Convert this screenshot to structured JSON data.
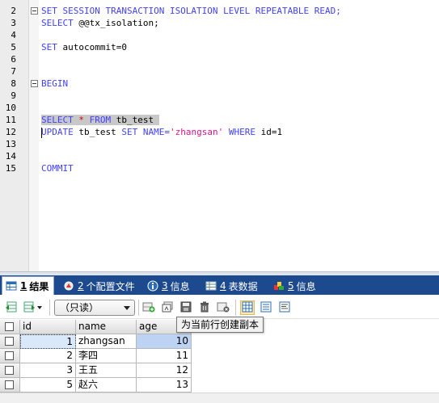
{
  "editor": {
    "lines": [
      {
        "no": "2",
        "fold": true,
        "tokens": [
          {
            "t": "SET SESSION TRANSACTION ISOLATION LEVEL REPEATABLE READ;",
            "c": "kw"
          }
        ]
      },
      {
        "no": "3",
        "fold": false,
        "tokens": [
          {
            "t": "SELECT ",
            "c": "kw"
          },
          {
            "t": "@@tx_isolation;",
            "c": ""
          }
        ]
      },
      {
        "no": "4",
        "fold": false,
        "tokens": []
      },
      {
        "no": "5",
        "fold": false,
        "tokens": [
          {
            "t": "SET ",
            "c": "kw"
          },
          {
            "t": "autocommit=0",
            "c": ""
          }
        ]
      },
      {
        "no": "6",
        "fold": false,
        "tokens": []
      },
      {
        "no": "7",
        "fold": false,
        "tokens": []
      },
      {
        "no": "8",
        "fold": true,
        "tokens": [
          {
            "t": "BEGIN",
            "c": "kw"
          }
        ]
      },
      {
        "no": "9",
        "fold": false,
        "tokens": []
      },
      {
        "no": "10",
        "fold": false,
        "tokens": []
      },
      {
        "no": "11",
        "fold": false,
        "selected": true,
        "tokens": [
          {
            "t": "SELECT ",
            "c": "kw"
          },
          {
            "t": "* ",
            "c": "op"
          },
          {
            "t": "FROM ",
            "c": "kw"
          },
          {
            "t": "tb_test ",
            "c": ""
          }
        ]
      },
      {
        "no": "12",
        "fold": false,
        "caret": true,
        "tokens": [
          {
            "t": "UPDATE ",
            "c": "kw"
          },
          {
            "t": "tb_test ",
            "c": ""
          },
          {
            "t": "SET ",
            "c": "kw"
          },
          {
            "t": "NAME=",
            "c": "kw"
          },
          {
            "t": "'zhangsan'",
            "c": "str"
          },
          {
            "t": " ",
            "c": ""
          },
          {
            "t": "WHERE ",
            "c": "kw"
          },
          {
            "t": "id=1",
            "c": ""
          }
        ]
      },
      {
        "no": "13",
        "fold": false,
        "tokens": []
      },
      {
        "no": "14",
        "fold": false,
        "tokens": []
      },
      {
        "no": "15",
        "fold": false,
        "tokens": [
          {
            "t": "COMMIT",
            "c": "kw"
          }
        ]
      }
    ]
  },
  "tabs": [
    {
      "num": "1",
      "label": "结果",
      "icon": "result-table-icon",
      "active": true
    },
    {
      "num": "2",
      "label": "个配置文件",
      "icon": "profile-icon",
      "active": false
    },
    {
      "num": "3",
      "label": "信息",
      "icon": "info-icon",
      "active": false
    },
    {
      "num": "4",
      "label": "表数据",
      "icon": "table-data-icon",
      "active": false
    },
    {
      "num": "5",
      "label": "信息",
      "icon": "info-colored-icon",
      "active": false
    }
  ],
  "toolbar": {
    "mode_value": "（只读）",
    "tooltip": "为当前行创建副本"
  },
  "grid": {
    "columns": [
      "id",
      "name",
      "age"
    ],
    "rows": [
      {
        "id": "1",
        "name": "zhangsan",
        "age": "10"
      },
      {
        "id": "2",
        "name": "李四",
        "age": "11"
      },
      {
        "id": "3",
        "name": "王五",
        "age": "12"
      },
      {
        "id": "5",
        "name": "赵六",
        "age": "13"
      }
    ]
  },
  "colors": {
    "keyword": "#4040ff",
    "string": "#e0108a",
    "tabbar": "#1d4a8e",
    "selected_cell": "#bcd3f3"
  }
}
